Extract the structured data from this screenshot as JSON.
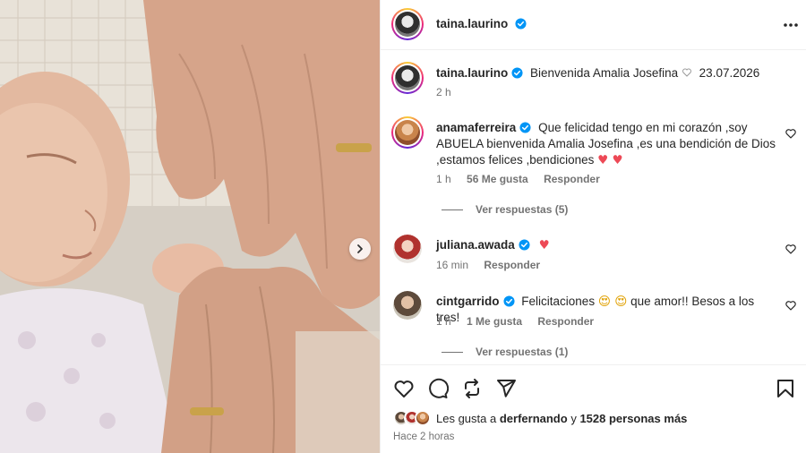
{
  "post": {
    "author": "taina.laurino",
    "caption": "Bienvenida Amalia Josefina",
    "caption_date": "23.07.2026",
    "caption_time": "2 h"
  },
  "comments": [
    {
      "user": "anamaferreira",
      "text": "Que felicidad tengo en mi corazón ,soy ABUELA bienvenida Amalia Josefina ,es una bendición de Dios ,estamos felices ,bendiciones",
      "emoji": "♥ ♥",
      "time": "1 h",
      "likes": "56 Me gusta",
      "reply": "Responder",
      "view_replies": "Ver respuestas (5)"
    },
    {
      "user": "juliana.awada",
      "text": "",
      "emoji": "♥",
      "time": "16 min",
      "reply": "Responder"
    },
    {
      "user": "cintgarrido",
      "text_before": "Felicitaciones",
      "emoji": "😍 😍",
      "text_after": "que amor!! Besos a los tres!",
      "time": "1 h",
      "likes": "1 Me gusta",
      "reply": "Responder",
      "view_replies": "Ver respuestas (1)"
    }
  ],
  "likes_summary": {
    "prefix": "Les gusta a",
    "user": "derfernando",
    "mid": "y",
    "count": "1528 personas más"
  },
  "posted_ago": "Hace 2 horas",
  "icons": {
    "more": "more-horizontal-icon",
    "verified": "verified-badge-icon",
    "like": "heart-outline-icon",
    "comment": "comment-bubble-icon",
    "repost": "repost-icon",
    "share": "send-paper-plane-icon",
    "save": "bookmark-icon",
    "next": "chevron-right-icon"
  },
  "colors": {
    "verified": "#0095f6",
    "heart": "#ed4956",
    "meta": "#737373"
  }
}
